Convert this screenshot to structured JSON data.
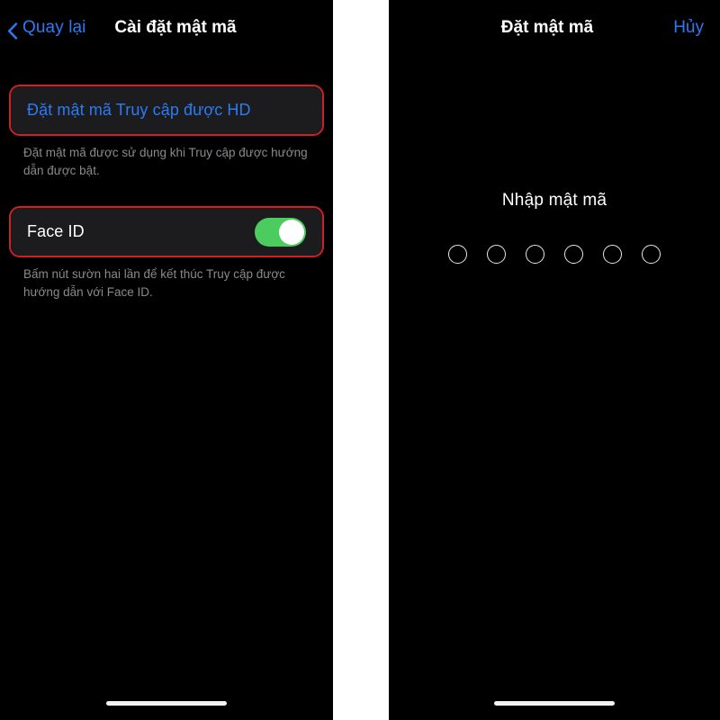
{
  "left_screen": {
    "nav": {
      "back_label": "Quay lại",
      "back_icon": "chevron-left-icon",
      "title": "Cài đặt mật mã"
    },
    "rows": [
      {
        "label": "Đặt mật mã Truy cập được HD",
        "type": "link",
        "highlighted": true,
        "footnote": "Đặt mật mã được sử dụng khi Truy cập được hướng dẫn được bật."
      },
      {
        "label": "Face ID",
        "type": "toggle",
        "toggle_state": "on",
        "highlighted": true,
        "footnote": "Bấm nút sườn hai lần để kết thúc Truy cập được hướng dẫn với Face ID."
      }
    ]
  },
  "right_screen": {
    "nav": {
      "title": "Đặt mật mã",
      "cancel_label": "Hủy"
    },
    "passcode": {
      "prompt": "Nhập mật mã",
      "digit_count": 6,
      "entered": 0
    }
  },
  "colors": {
    "background": "#000000",
    "row_background": "#1c1c1e",
    "accent_blue": "#2b7bf3",
    "highlight_red": "#cf2026",
    "toggle_on_green": "#4ccb5f",
    "footnote_gray": "#8a8a8e",
    "divider_white": "#ffffff"
  }
}
